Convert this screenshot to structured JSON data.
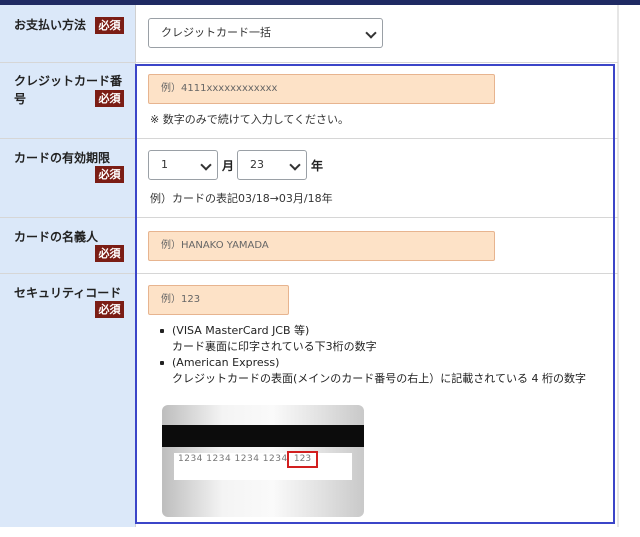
{
  "payment_method": {
    "label": "お支払い方法",
    "required_badge": "必須",
    "selected": "クレジットカード一括"
  },
  "card_number": {
    "label": "クレジットカード番号",
    "required_badge": "必須",
    "placeholder": "例）4111xxxxxxxxxxxx",
    "note": "※ 数字のみで続けて入力してください。"
  },
  "expiry": {
    "label": "カードの有効期限",
    "required_badge": "必須",
    "month_value": "1",
    "month_unit": "月",
    "year_value": "23",
    "year_unit": "年",
    "note": "例）カードの表記03/18→03月/18年"
  },
  "holder_name": {
    "label": "カードの名義人",
    "required_badge": "必須",
    "placeholder": "例）HANAKO YAMADA"
  },
  "security_code": {
    "label": "セキュリティコード",
    "required_badge": "必須",
    "placeholder": "例）123",
    "hints": [
      {
        "brand": "(VISA MasterCard JCB 等)",
        "desc": "カード裏面に印字されている下3桁の数字"
      },
      {
        "brand": "(American Express)",
        "desc": "クレジットカードの表面(メインのカード番号の右上）に記載されている 4 桁の数字"
      }
    ],
    "card_image": {
      "number_text": "1234  1234  1234  1234",
      "cvv_text": "123"
    }
  },
  "colors": {
    "required_badge_bg": "#7b1d15",
    "label_column_bg": "#dbe8f9",
    "input_bg": "#fde2c7",
    "focus_outline": "#3b45c8",
    "cvv_highlight": "#d21f1f"
  }
}
